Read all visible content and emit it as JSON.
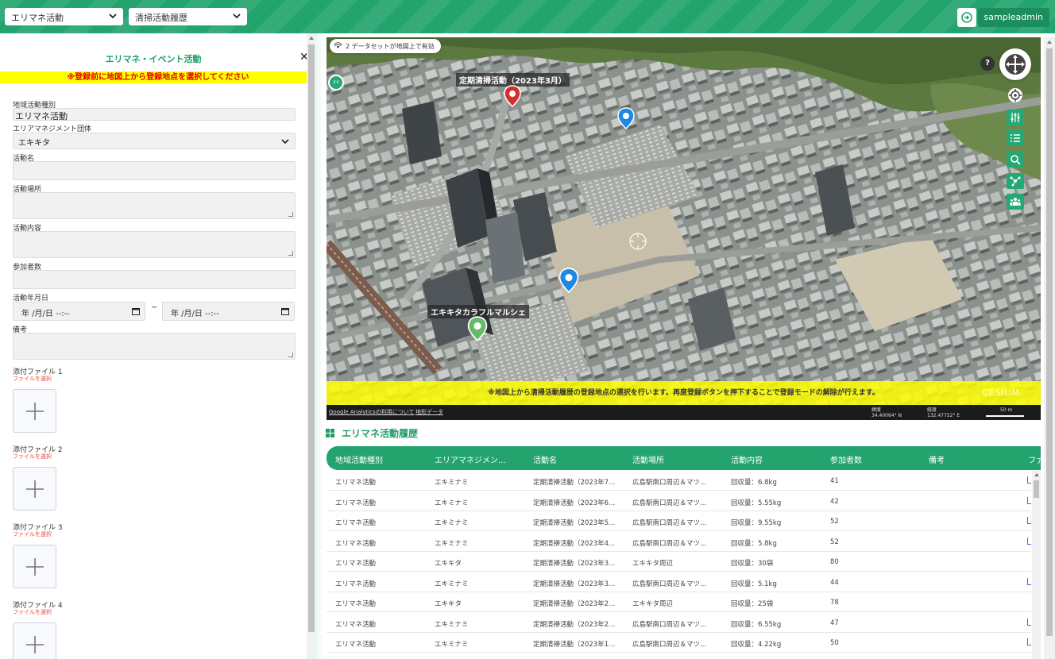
{
  "header": {
    "select1": "エリマネ活動",
    "select2": "清掃活動履歴",
    "user": "sampleadmin"
  },
  "form": {
    "title": "エリマネ・イベント活動",
    "warning": "※登録前に地図上から登録地点を選択してください",
    "fields": {
      "type_label": "地域活動種別",
      "type_value": "エリマネ活動",
      "org_label": "エリアマネジメント団体",
      "org_value": "エキキタ",
      "name_label": "活動名",
      "place_label": "活動場所",
      "content_label": "活動内容",
      "participants_label": "参加者数",
      "date_label": "活動年月日",
      "date_from": "年 /月/日 --:--",
      "date_tilde": "~",
      "date_to": "年 /月/日 --:--",
      "notes_label": "備考"
    },
    "files": [
      {
        "label": "添付ファイル 1",
        "sub": "ファイルを選択"
      },
      {
        "label": "添付ファイル 2",
        "sub": "ファイルを選択"
      },
      {
        "label": "添付ファイル 3",
        "sub": "ファイルを選択"
      },
      {
        "label": "添付ファイル 4",
        "sub": "ファイルを選択"
      }
    ]
  },
  "map": {
    "badge": "2 データセットが地図上で有効",
    "label_top": "定期清掃活動（2023年3月）",
    "label_bottom": "エキキタカラフルマルシェ",
    "banner": "※地図上から清掃活動履歴の登録地点の選択を行います。再度登録ボタンを押下することで登録モードの解除が行えます。",
    "cesium": "CESIUM",
    "footer_link1": "Google Analyticsの利用について",
    "footer_link2": "地形データ",
    "lat_label": "緯度",
    "lat_value": "34.40064° N",
    "lon_label": "経度",
    "lon_value": "132.47752° E",
    "scale": "50 m",
    "help": "?",
    "collapse": "‹‹"
  },
  "history": {
    "title": "エリマネ活動履歴",
    "columns": [
      "地域活動種別",
      "エリアマネジメン...",
      "活動名",
      "活動場所",
      "活動内容",
      "参加者数",
      "備考",
      "ファ"
    ],
    "rows": [
      [
        "エリマネ活動",
        "エキミナミ",
        "定期清掃活動（2023年7...",
        "広島駅南口周辺＆マツ...",
        "回収量：6.8kg",
        "41",
        "",
        true
      ],
      [
        "エリマネ活動",
        "エキミナミ",
        "定期清掃活動（2023年6...",
        "広島駅南口周辺＆マツ...",
        "回収量：5.55kg",
        "42",
        "",
        true
      ],
      [
        "エリマネ活動",
        "エキミナミ",
        "定期清掃活動（2023年5...",
        "広島駅南口周辺＆マツ...",
        "回収量：9.55kg",
        "52",
        "",
        true
      ],
      [
        "エリマネ活動",
        "エキミナミ",
        "定期清掃活動（2023年4...",
        "広島駅南口周辺＆マツ...",
        "回収量：5.8kg",
        "52",
        "",
        true
      ],
      [
        "エリマネ活動",
        "エキキタ",
        "定期清掃活動（2023年3...",
        "エキキタ周辺",
        "回収量：30袋",
        "80",
        "",
        false
      ],
      [
        "エリマネ活動",
        "エキミナミ",
        "定期清掃活動（2023年3...",
        "広島駅南口周辺＆マツ...",
        "回収量：5.1kg",
        "44",
        "",
        true
      ],
      [
        "エリマネ活動",
        "エキキタ",
        "定期清掃活動（2023年2...",
        "エキキタ周辺",
        "回収量：25袋",
        "78",
        "",
        false
      ],
      [
        "エリマネ活動",
        "エキミナミ",
        "定期清掃活動（2023年2...",
        "広島駅南口周辺＆マツ...",
        "回収量：6.55kg",
        "47",
        "",
        true
      ],
      [
        "エリマネ活動",
        "エキミナミ",
        "定期清掃活動（2023年1...",
        "広島駅南口周辺＆マツ...",
        "回収量：4.22kg",
        "50",
        "",
        true
      ]
    ]
  },
  "colors": {
    "brand": "#23a46e",
    "warning_bg": "#ffff00",
    "warning_text": "#e60000"
  }
}
